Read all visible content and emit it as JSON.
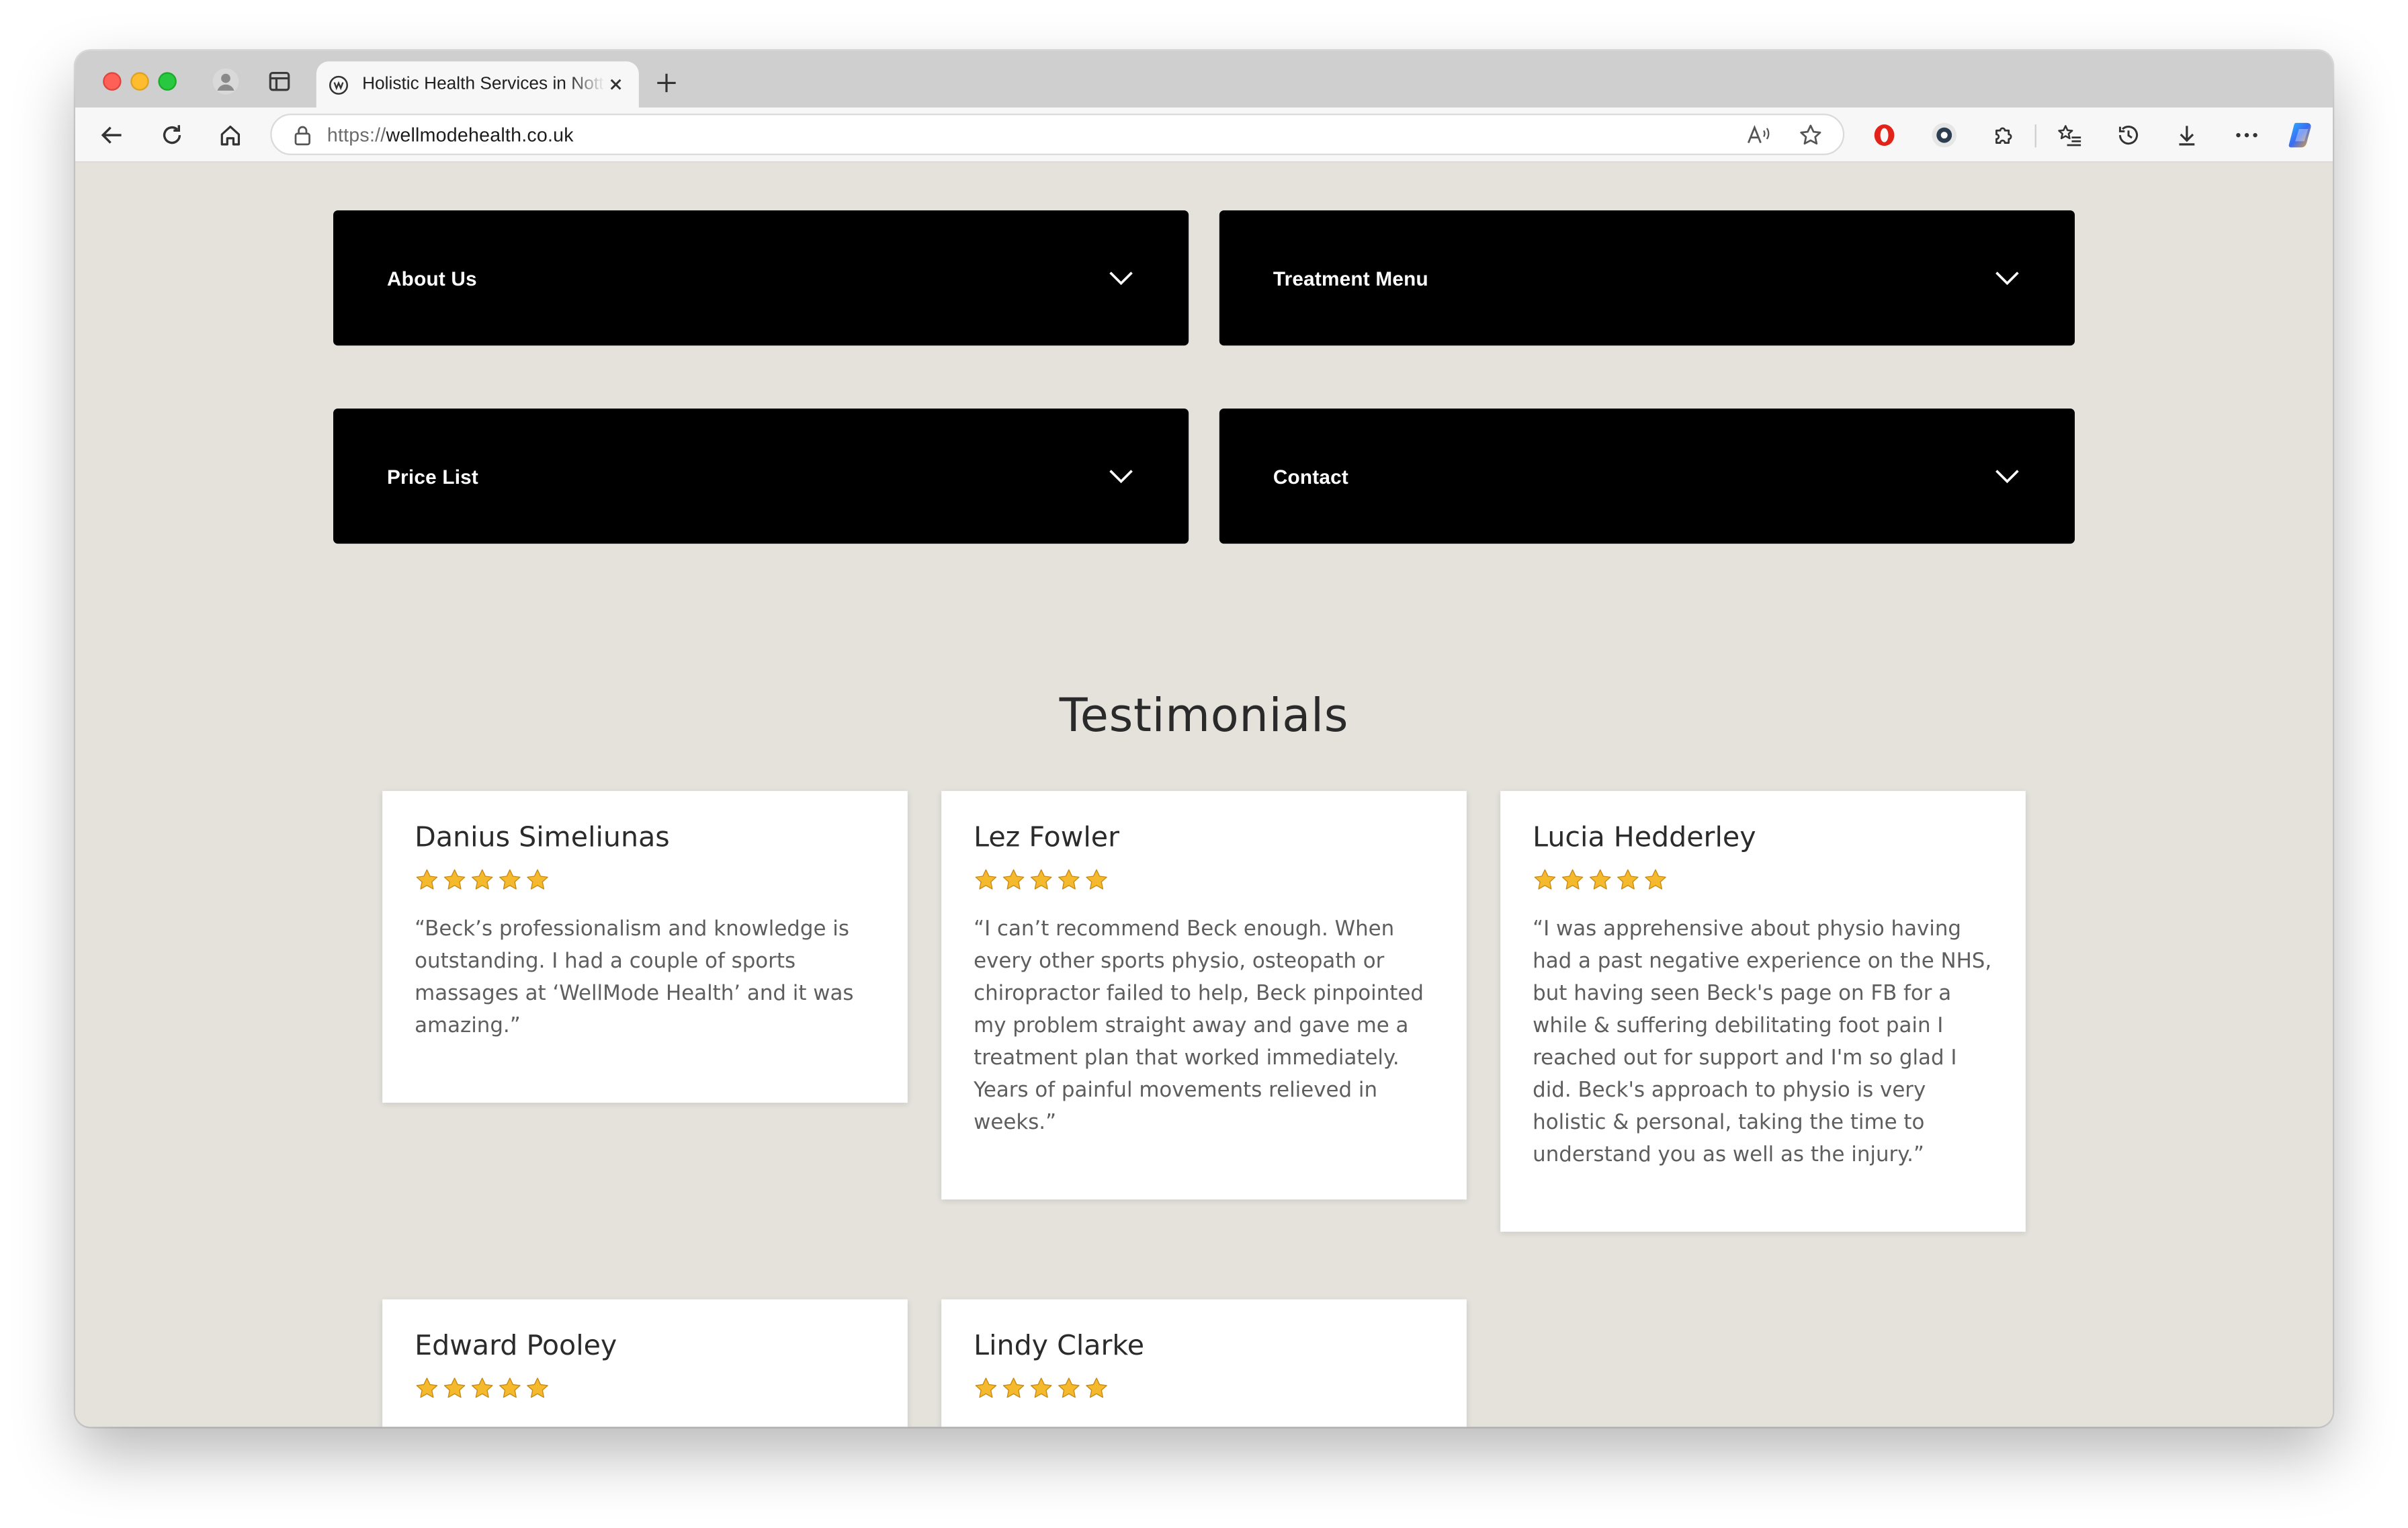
{
  "browser": {
    "tab": {
      "title": "Holistic Health Services in Nottingham"
    },
    "address": {
      "protocol": "https://",
      "domain": "wellmodehealth.co.uk"
    }
  },
  "accordions": [
    {
      "label": "About Us"
    },
    {
      "label": "Treatment Menu"
    },
    {
      "label": "Price List"
    },
    {
      "label": "Contact"
    }
  ],
  "testimonials": {
    "title": "Testimonials",
    "rating_stars": 5,
    "star_color": "#f5b92e",
    "items": [
      {
        "name": "Danius Simeliunas",
        "text": "“Beck’s professionalism and knowledge is outstanding. I had a couple of sports massages at ‘WellMode Health’ and it was amazing.”"
      },
      {
        "name": "Lez Fowler",
        "text": "“I can’t recommend Beck enough. When every other sports physio, osteopath or chiropractor failed to help, Beck pinpointed my problem straight away and gave me a treatment plan that worked immediately. Years of painful movements relieved in weeks.”"
      },
      {
        "name": "Lucia Hedderley",
        "text": "“I was apprehensive about physio having had a past negative experience on the NHS, but having seen Beck's page on FB for a while & suffering debilitating foot pain I reached out for support and I'm so glad I did. Beck's approach to physio is very holistic & personal, taking the time to understand you as well as the injury.”"
      },
      {
        "name": "Edward Pooley",
        "text": ""
      },
      {
        "name": "Lindy Clarke",
        "text": ""
      }
    ]
  },
  "colors": {
    "accordion_bg": "#000000",
    "page_bg": "#e5e2dc"
  }
}
